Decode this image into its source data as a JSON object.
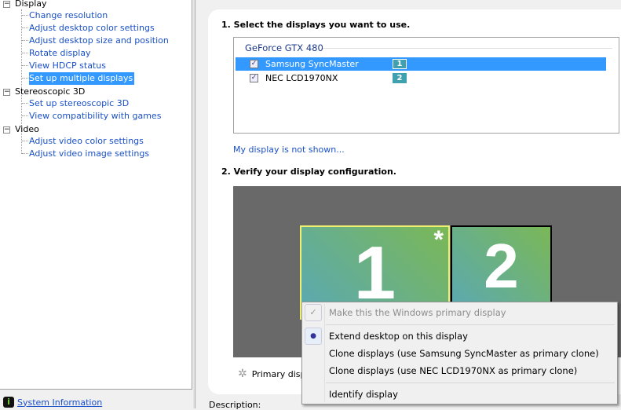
{
  "tree": {
    "groups": [
      {
        "label": "Display",
        "items": [
          "Change resolution",
          "Adjust desktop color settings",
          "Adjust desktop size and position",
          "Rotate display",
          "View HDCP status",
          "Set up multiple displays"
        ]
      },
      {
        "label": "Stereoscopic 3D",
        "items": [
          "Set up stereoscopic 3D",
          "View compatibility with games"
        ]
      },
      {
        "label": "Video",
        "items": [
          "Adjust video color settings",
          "Adjust video image settings"
        ]
      }
    ],
    "selected": "Set up multiple displays"
  },
  "system_info": "System Information",
  "step1": {
    "title": "1. Select the displays you want to use.",
    "gpu": "GeForce GTX 480",
    "displays": [
      {
        "name": "Samsung SyncMaster",
        "number": "1",
        "checked": true
      },
      {
        "name": "NEC LCD1970NX",
        "number": "2",
        "checked": true
      }
    ]
  },
  "not_shown_link": "My display is not shown...",
  "step2": {
    "title": "2. Verify your display configuration.",
    "monitor1": "1",
    "monitor2": "2",
    "primary_mark": "*"
  },
  "primary_label": "Primary display",
  "description_label": "Description:",
  "context_menu": {
    "make_primary": "Make this the Windows primary display",
    "extend": "Extend desktop on this display",
    "clone_samsung": "Clone displays (use Samsung SyncMaster as primary clone)",
    "clone_nec": "Clone displays (use NEC LCD1970NX as primary clone)",
    "identify": "Identify display"
  }
}
